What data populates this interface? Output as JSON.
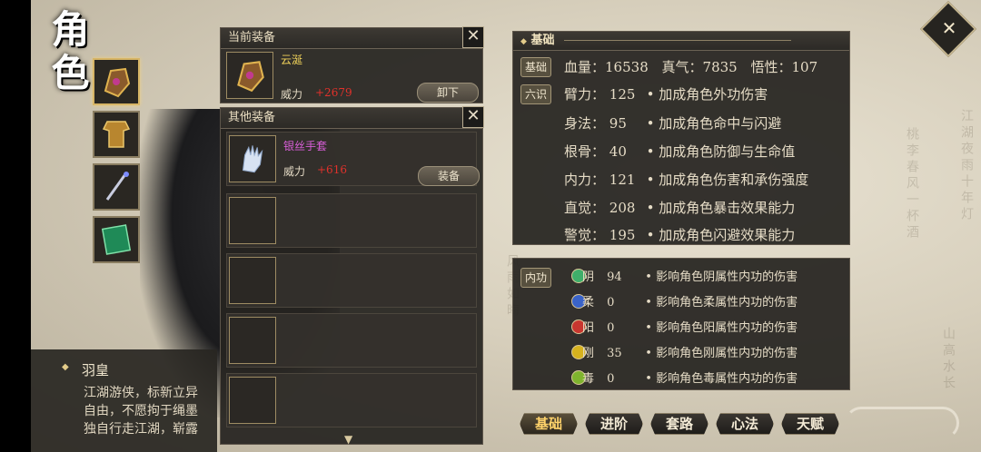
{
  "title": "角色",
  "equip_slots": [
    {
      "icon": "gauntlet-icon",
      "active": true
    },
    {
      "icon": "armor-icon",
      "active": false
    },
    {
      "icon": "sword-icon",
      "active": false
    },
    {
      "icon": "book-icon",
      "active": false
    }
  ],
  "current_equip": {
    "header": "当前装备",
    "item": {
      "name": "云涎",
      "power_label": "威力",
      "power_value": "+2679",
      "button": "卸下"
    },
    "colors": {
      "name": "#f0d25a"
    }
  },
  "other_equip": {
    "header": "其他装备",
    "item": {
      "name": "银丝手套",
      "power_label": "威力",
      "power_value": "+616",
      "button": "装备"
    },
    "colors": {
      "name": "#d85ed8"
    }
  },
  "character": {
    "name": "羽皇",
    "desc_lines": [
      "江湖游侠，标新立异",
      "自由，不愿拘于绳墨",
      "独自行走江湖，崭露"
    ]
  },
  "basics": {
    "header": "基础",
    "tag_basic": "基础",
    "tag_six": "六识",
    "hp_label": "血量：",
    "hp": "16538",
    "qi_label": "真气：",
    "qi": "7835",
    "wu_label": "悟性：",
    "wu": "107",
    "stats": [
      {
        "label": "臂力：",
        "value": "125",
        "desc": "• 加成角色外功伤害"
      },
      {
        "label": "身法：",
        "value": "95",
        "desc": "• 加成角色命中与闪避"
      },
      {
        "label": "根骨：",
        "value": "40",
        "desc": "• 加成角色防御与生命值"
      },
      {
        "label": "内力：",
        "value": "121",
        "desc": "• 加成角色伤害和承伤强度"
      },
      {
        "label": "直觉：",
        "value": "208",
        "desc": "• 加成角色暴击效果能力"
      },
      {
        "label": "警觉：",
        "value": "195",
        "desc": "• 加成角色闪避效果能力"
      }
    ]
  },
  "neigong": {
    "tag": "内功",
    "rows": [
      {
        "char": "阴",
        "value": "94",
        "desc": "• 影响角色阴属性内功的伤害",
        "color": "#3fae6a"
      },
      {
        "char": "柔",
        "value": "0",
        "desc": "• 影响角色柔属性内功的伤害",
        "color": "#3a63c8"
      },
      {
        "char": "阳",
        "value": "0",
        "desc": "• 影响角色阳属性内功的伤害",
        "color": "#c8362f"
      },
      {
        "char": "刚",
        "value": "35",
        "desc": "• 影响角色刚属性内功的伤害",
        "color": "#d6b21e"
      },
      {
        "char": "毒",
        "value": "0",
        "desc": "• 影响角色毒属性内功的伤害",
        "color": "#7fb42e"
      }
    ]
  },
  "tabs": [
    "基础",
    "进阶",
    "套路",
    "心法",
    "天赋"
  ]
}
